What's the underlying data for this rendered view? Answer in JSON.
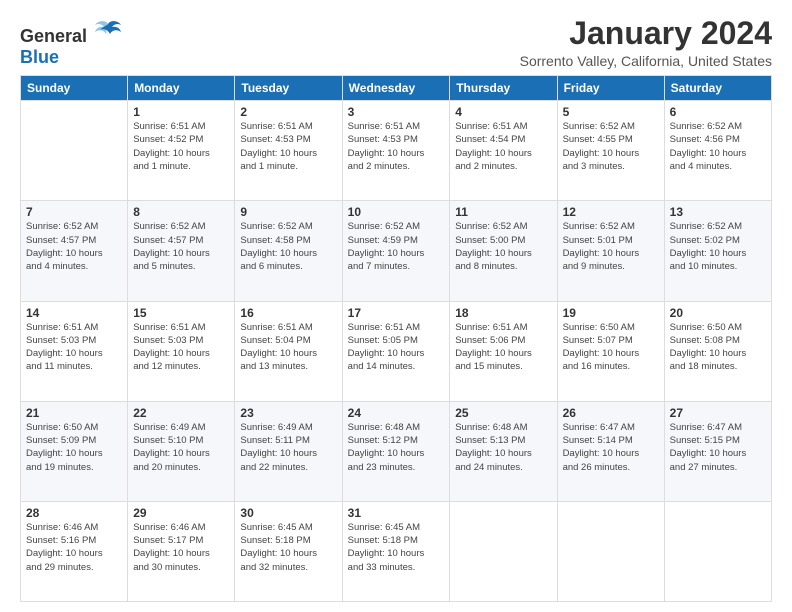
{
  "header": {
    "logo_general": "General",
    "logo_blue": "Blue",
    "title": "January 2024",
    "subtitle": "Sorrento Valley, California, United States"
  },
  "weekdays": [
    "Sunday",
    "Monday",
    "Tuesday",
    "Wednesday",
    "Thursday",
    "Friday",
    "Saturday"
  ],
  "weeks": [
    [
      {
        "day": "",
        "info": ""
      },
      {
        "day": "1",
        "info": "Sunrise: 6:51 AM\nSunset: 4:52 PM\nDaylight: 10 hours\nand 1 minute."
      },
      {
        "day": "2",
        "info": "Sunrise: 6:51 AM\nSunset: 4:53 PM\nDaylight: 10 hours\nand 1 minute."
      },
      {
        "day": "3",
        "info": "Sunrise: 6:51 AM\nSunset: 4:53 PM\nDaylight: 10 hours\nand 2 minutes."
      },
      {
        "day": "4",
        "info": "Sunrise: 6:51 AM\nSunset: 4:54 PM\nDaylight: 10 hours\nand 2 minutes."
      },
      {
        "day": "5",
        "info": "Sunrise: 6:52 AM\nSunset: 4:55 PM\nDaylight: 10 hours\nand 3 minutes."
      },
      {
        "day": "6",
        "info": "Sunrise: 6:52 AM\nSunset: 4:56 PM\nDaylight: 10 hours\nand 4 minutes."
      }
    ],
    [
      {
        "day": "7",
        "info": "Sunrise: 6:52 AM\nSunset: 4:57 PM\nDaylight: 10 hours\nand 4 minutes."
      },
      {
        "day": "8",
        "info": "Sunrise: 6:52 AM\nSunset: 4:57 PM\nDaylight: 10 hours\nand 5 minutes."
      },
      {
        "day": "9",
        "info": "Sunrise: 6:52 AM\nSunset: 4:58 PM\nDaylight: 10 hours\nand 6 minutes."
      },
      {
        "day": "10",
        "info": "Sunrise: 6:52 AM\nSunset: 4:59 PM\nDaylight: 10 hours\nand 7 minutes."
      },
      {
        "day": "11",
        "info": "Sunrise: 6:52 AM\nSunset: 5:00 PM\nDaylight: 10 hours\nand 8 minutes."
      },
      {
        "day": "12",
        "info": "Sunrise: 6:52 AM\nSunset: 5:01 PM\nDaylight: 10 hours\nand 9 minutes."
      },
      {
        "day": "13",
        "info": "Sunrise: 6:52 AM\nSunset: 5:02 PM\nDaylight: 10 hours\nand 10 minutes."
      }
    ],
    [
      {
        "day": "14",
        "info": "Sunrise: 6:51 AM\nSunset: 5:03 PM\nDaylight: 10 hours\nand 11 minutes."
      },
      {
        "day": "15",
        "info": "Sunrise: 6:51 AM\nSunset: 5:03 PM\nDaylight: 10 hours\nand 12 minutes."
      },
      {
        "day": "16",
        "info": "Sunrise: 6:51 AM\nSunset: 5:04 PM\nDaylight: 10 hours\nand 13 minutes."
      },
      {
        "day": "17",
        "info": "Sunrise: 6:51 AM\nSunset: 5:05 PM\nDaylight: 10 hours\nand 14 minutes."
      },
      {
        "day": "18",
        "info": "Sunrise: 6:51 AM\nSunset: 5:06 PM\nDaylight: 10 hours\nand 15 minutes."
      },
      {
        "day": "19",
        "info": "Sunrise: 6:50 AM\nSunset: 5:07 PM\nDaylight: 10 hours\nand 16 minutes."
      },
      {
        "day": "20",
        "info": "Sunrise: 6:50 AM\nSunset: 5:08 PM\nDaylight: 10 hours\nand 18 minutes."
      }
    ],
    [
      {
        "day": "21",
        "info": "Sunrise: 6:50 AM\nSunset: 5:09 PM\nDaylight: 10 hours\nand 19 minutes."
      },
      {
        "day": "22",
        "info": "Sunrise: 6:49 AM\nSunset: 5:10 PM\nDaylight: 10 hours\nand 20 minutes."
      },
      {
        "day": "23",
        "info": "Sunrise: 6:49 AM\nSunset: 5:11 PM\nDaylight: 10 hours\nand 22 minutes."
      },
      {
        "day": "24",
        "info": "Sunrise: 6:48 AM\nSunset: 5:12 PM\nDaylight: 10 hours\nand 23 minutes."
      },
      {
        "day": "25",
        "info": "Sunrise: 6:48 AM\nSunset: 5:13 PM\nDaylight: 10 hours\nand 24 minutes."
      },
      {
        "day": "26",
        "info": "Sunrise: 6:47 AM\nSunset: 5:14 PM\nDaylight: 10 hours\nand 26 minutes."
      },
      {
        "day": "27",
        "info": "Sunrise: 6:47 AM\nSunset: 5:15 PM\nDaylight: 10 hours\nand 27 minutes."
      }
    ],
    [
      {
        "day": "28",
        "info": "Sunrise: 6:46 AM\nSunset: 5:16 PM\nDaylight: 10 hours\nand 29 minutes."
      },
      {
        "day": "29",
        "info": "Sunrise: 6:46 AM\nSunset: 5:17 PM\nDaylight: 10 hours\nand 30 minutes."
      },
      {
        "day": "30",
        "info": "Sunrise: 6:45 AM\nSunset: 5:18 PM\nDaylight: 10 hours\nand 32 minutes."
      },
      {
        "day": "31",
        "info": "Sunrise: 6:45 AM\nSunset: 5:18 PM\nDaylight: 10 hours\nand 33 minutes."
      },
      {
        "day": "",
        "info": ""
      },
      {
        "day": "",
        "info": ""
      },
      {
        "day": "",
        "info": ""
      }
    ]
  ]
}
